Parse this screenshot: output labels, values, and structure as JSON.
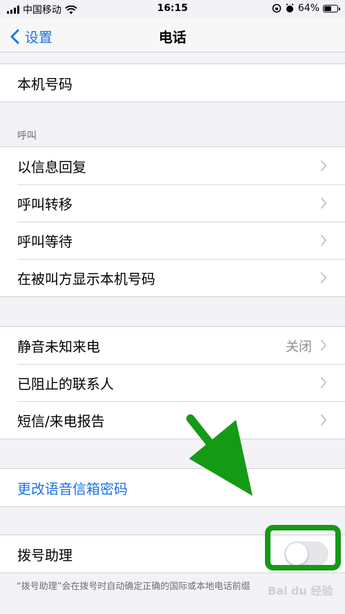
{
  "status_bar": {
    "carrier": "中国移动",
    "time": "16:15",
    "battery_percent": "64%",
    "battery_level": 0.64,
    "icons": [
      "signal-icon",
      "wifi-icon",
      "rotation-lock-icon",
      "alarm-icon",
      "battery-icon"
    ]
  },
  "nav": {
    "back_label": "设置",
    "title": "电话"
  },
  "my_number": {
    "label": "本机号码"
  },
  "calls": {
    "header": "呼叫",
    "items": [
      {
        "label": "以信息回复"
      },
      {
        "label": "呼叫转移"
      },
      {
        "label": "呼叫等待"
      },
      {
        "label": "在被叫方显示本机号码"
      }
    ]
  },
  "silence": {
    "items": [
      {
        "label": "静音未知来电",
        "value": "关闭"
      },
      {
        "label": "已阻止的联系人"
      },
      {
        "label": "短信/来电报告"
      }
    ]
  },
  "voicemail": {
    "label": "更改语音信箱密码"
  },
  "dial_assist": {
    "label": "拨号助理",
    "enabled": false,
    "note": "“拨号助理”会在拨号时自动确定正确的国际或本地电话前缀"
  },
  "watermark": "Bai du 经验",
  "colors": {
    "accent": "#1a73e8",
    "highlight": "#159a15",
    "background": "#f2f2f7"
  }
}
